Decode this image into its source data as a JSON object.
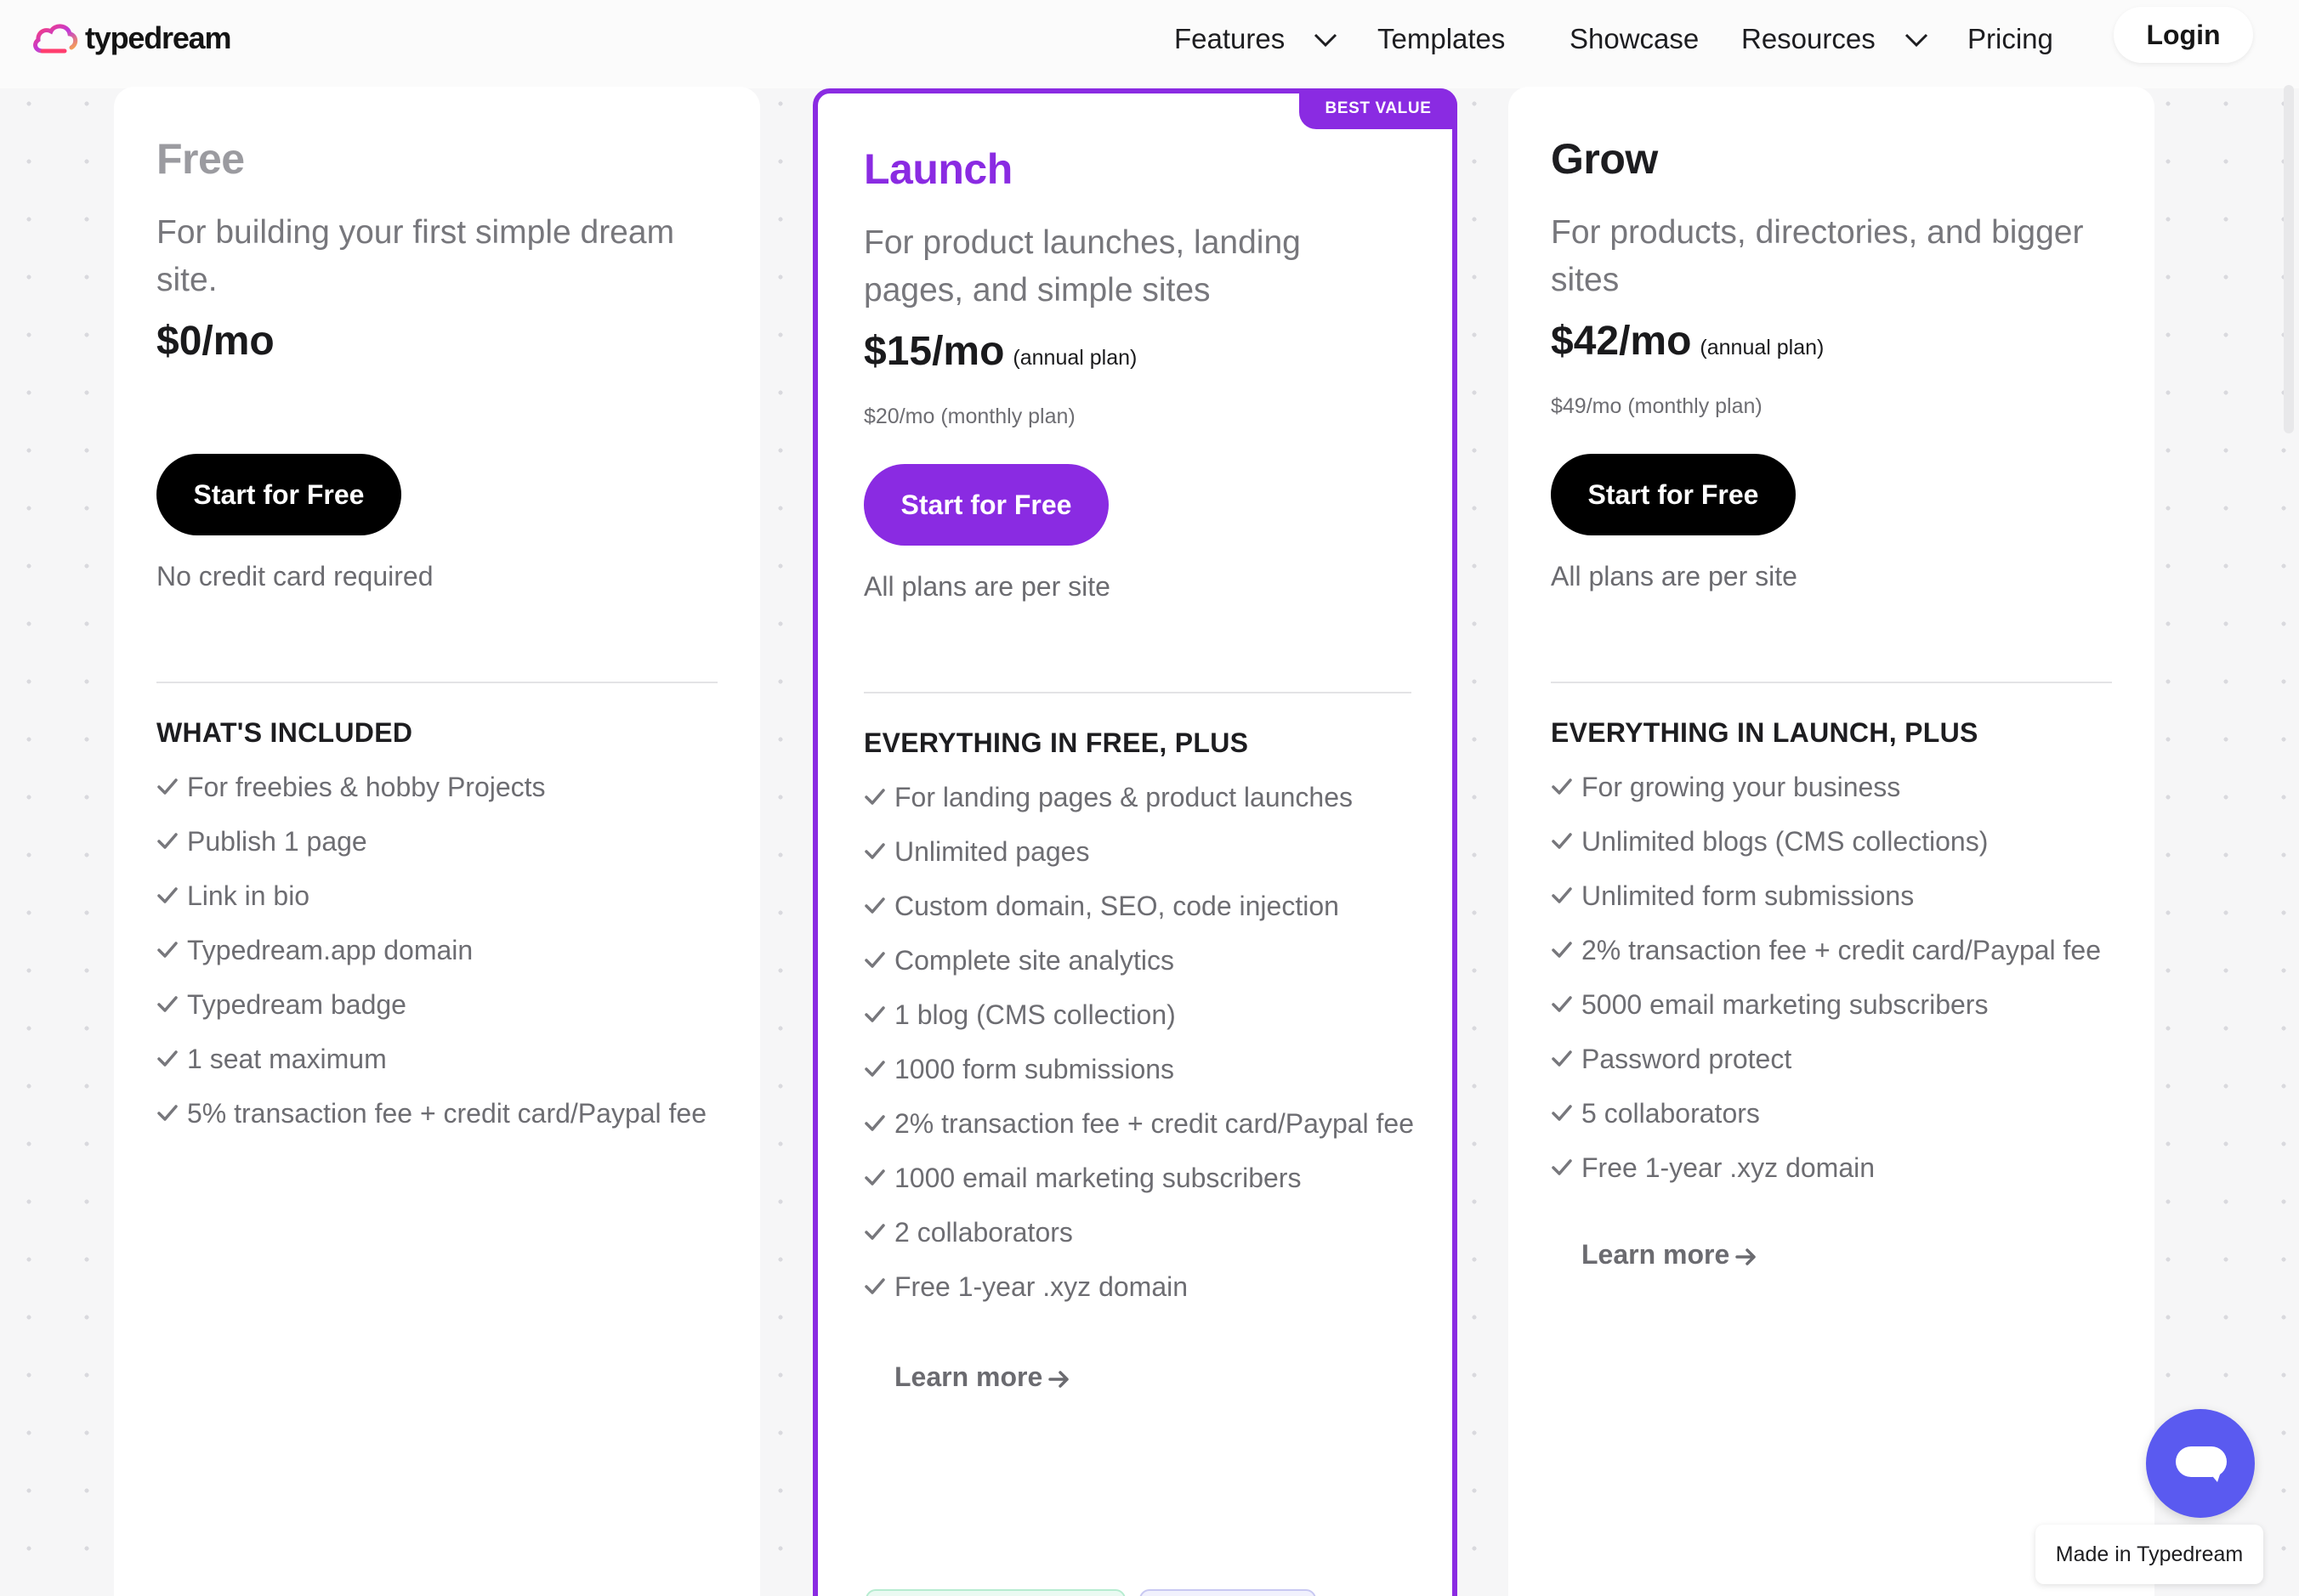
{
  "nav": {
    "brand": "typedream",
    "items": [
      {
        "label": "Features",
        "has_dropdown": true
      },
      {
        "label": "Templates",
        "has_dropdown": false
      },
      {
        "label": "Showcase",
        "has_dropdown": false
      },
      {
        "label": "Resources",
        "has_dropdown": true
      },
      {
        "label": "Pricing",
        "has_dropdown": false
      }
    ],
    "login": "Login"
  },
  "colors": {
    "accent": "#8a2be2",
    "chat": "#5a5af0",
    "dark_button": "#000000"
  },
  "plans": [
    {
      "name": "Free",
      "name_color": "#9b9ba0",
      "description": "For building your first simple dream site.",
      "price": "$0/mo",
      "price_note": "",
      "monthly": "",
      "cta": "Start for Free",
      "cta_style": "dark",
      "subnote": "No credit card required",
      "section_title": "WHAT'S INCLUDED",
      "features": [
        "For freebies & hobby Projects",
        "Publish 1 page",
        "Link in bio",
        "Typedream.app domain",
        "Typedream badge",
        "1 seat maximum",
        "5% transaction fee + credit card/Paypal fee"
      ],
      "learn_more": ""
    },
    {
      "name": "Launch",
      "name_color": "#8a2be2",
      "badge": "BEST VALUE",
      "description": "For product launches, landing pages, and simple sites",
      "price": "$15/mo",
      "price_note": "(annual plan)",
      "monthly": "$20/mo (monthly plan)",
      "cta": "Start for Free",
      "cta_style": "purple",
      "subnote": "All plans are per site",
      "section_title": "EVERYTHING IN FREE, PLUS",
      "features": [
        "For landing pages & product launches",
        "Unlimited pages",
        "Custom domain, SEO, code injection",
        "Complete site analytics",
        "1 blog (CMS collection)",
        "1000 form submissions",
        "2% transaction fee + credit card/Paypal fee",
        "1000 email marketing subscribers",
        "2 collaborators",
        "Free 1-year .xyz domain"
      ],
      "learn_more": "Learn more"
    },
    {
      "name": "Grow",
      "name_color": "#1d1d20",
      "description": "For products, directories, and bigger sites",
      "price": "$42/mo",
      "price_note": "(annual plan)",
      "monthly": "$49/mo (monthly plan)",
      "cta": "Start for Free",
      "cta_style": "dark",
      "subnote": "All plans are per site",
      "section_title": "EVERYTHING IN LAUNCH, PLUS",
      "features": [
        "For growing your business",
        "Unlimited blogs (CMS collections)",
        "Unlimited form submissions",
        "2% transaction fee + credit card/Paypal fee",
        "5000 email marketing subscribers",
        "Password protect",
        "5 collaborators",
        "Free 1-year .xyz domain"
      ],
      "learn_more": "Learn more"
    }
  ],
  "footer": {
    "made_in": "Made in Typedream"
  }
}
